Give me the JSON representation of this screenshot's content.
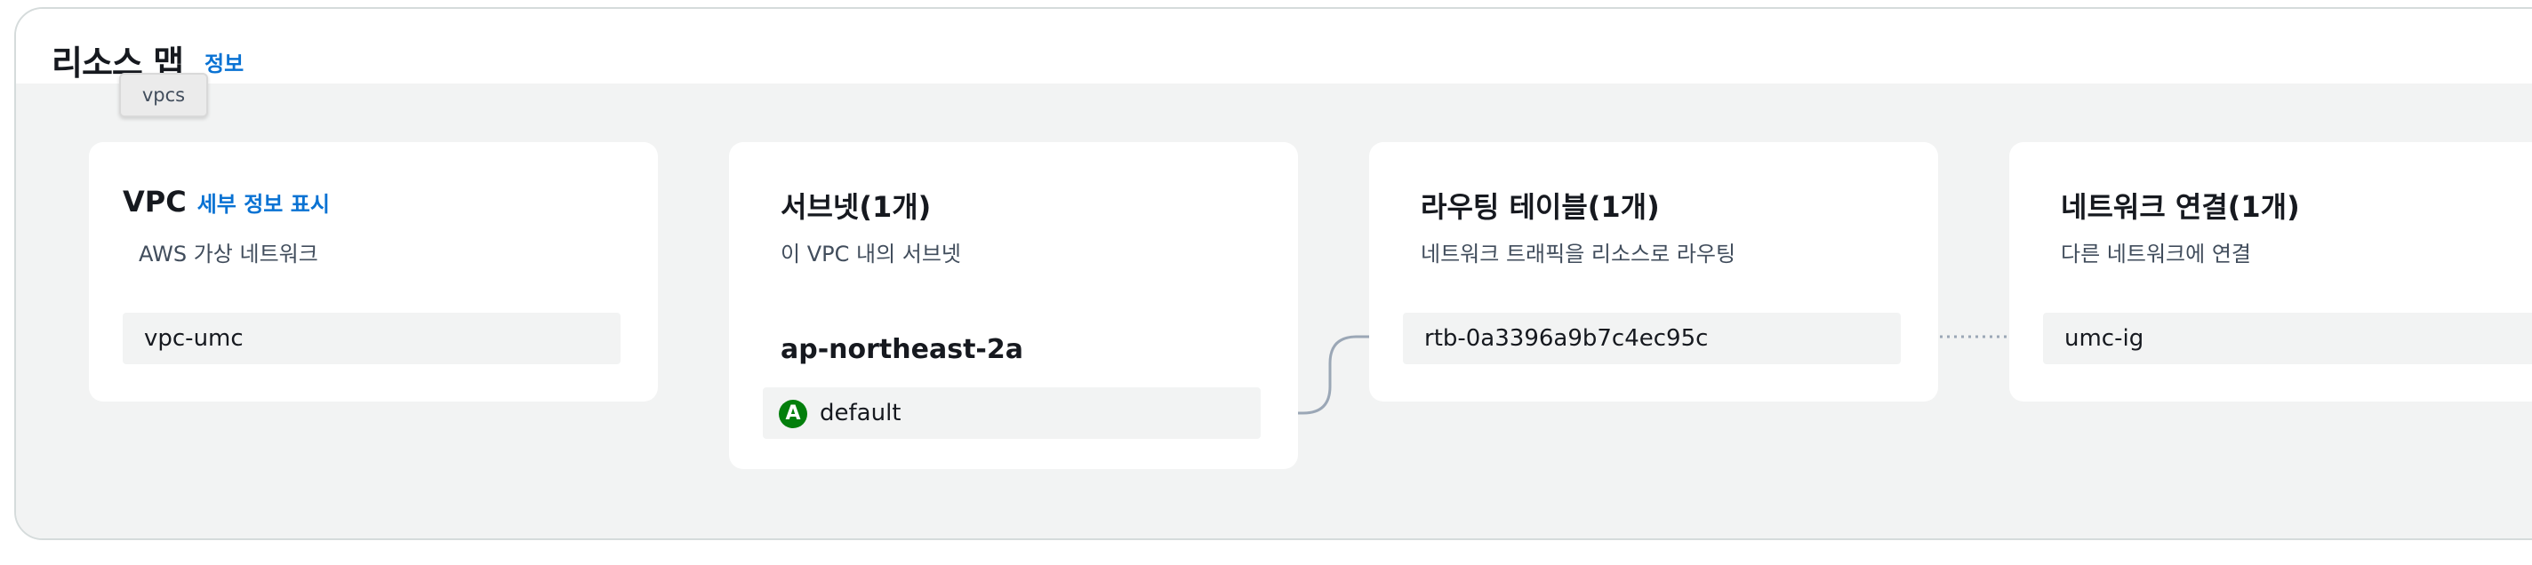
{
  "header": {
    "title": "리소스 맵",
    "info_link": "정보",
    "tooltip": "vpcs"
  },
  "vpc_card": {
    "title": "VPC",
    "details_link": "세부 정보 표시",
    "description": "AWS 가상 네트워크",
    "item": "vpc-umc"
  },
  "subnet_card": {
    "title": "서브넷(1개)",
    "description": "이 VPC 내의 서브넷",
    "az": "ap-northeast-2a",
    "item_badge": "A",
    "item": "default"
  },
  "route_card": {
    "title": "라우팅 테이블(1개)",
    "description": "네트워크 트래픽을 리소스로 라우팅",
    "item": "rtb-0a3396a9b7c4ec95c"
  },
  "network_card": {
    "title": "네트워크 연결(1개)",
    "description": "다른 네트워크에 연결",
    "item": "umc-ig"
  },
  "colors": {
    "link": "#0972d3",
    "badge": "#037f0c",
    "canvas_bg": "#f2f3f3",
    "connector": "#9ba7b6"
  }
}
